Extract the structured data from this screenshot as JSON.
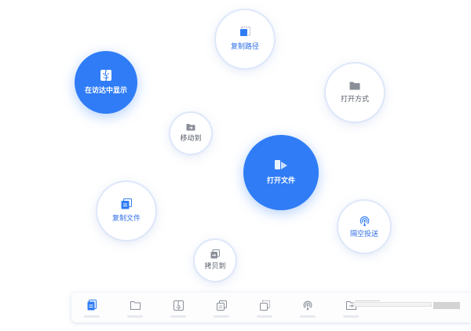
{
  "bubbles": {
    "copy_path": {
      "label": "复制路径",
      "icon": "copy-path-icon"
    },
    "show_in_finder": {
      "label": "在访达中显示",
      "icon": "finder-icon"
    },
    "open_with": {
      "label": "打开方式",
      "icon": "folder-icon"
    },
    "move_to": {
      "label": "移动到",
      "icon": "move-folder-icon"
    },
    "open_file": {
      "label": "打开文件",
      "icon": "open-file-icon"
    },
    "copy_file": {
      "label": "复制文件",
      "icon": "copy-file-icon"
    },
    "airdrop": {
      "label": "隔空投送",
      "icon": "airdrop-icon"
    },
    "copy_to": {
      "label": "拷贝到",
      "icon": "copy-to-icon"
    }
  },
  "dock": {
    "items": [
      {
        "icon": "document-icon",
        "active": true
      },
      {
        "icon": "folder-icon"
      },
      {
        "icon": "finder-icon"
      },
      {
        "icon": "copy-icon"
      },
      {
        "icon": "copy-path-icon"
      },
      {
        "icon": "airdrop-icon"
      },
      {
        "icon": "move-icon"
      }
    ]
  },
  "colors": {
    "accent": "#2f7cf6",
    "accent_text": "#2f6ee6",
    "icon_gray": "#8a8f98"
  }
}
